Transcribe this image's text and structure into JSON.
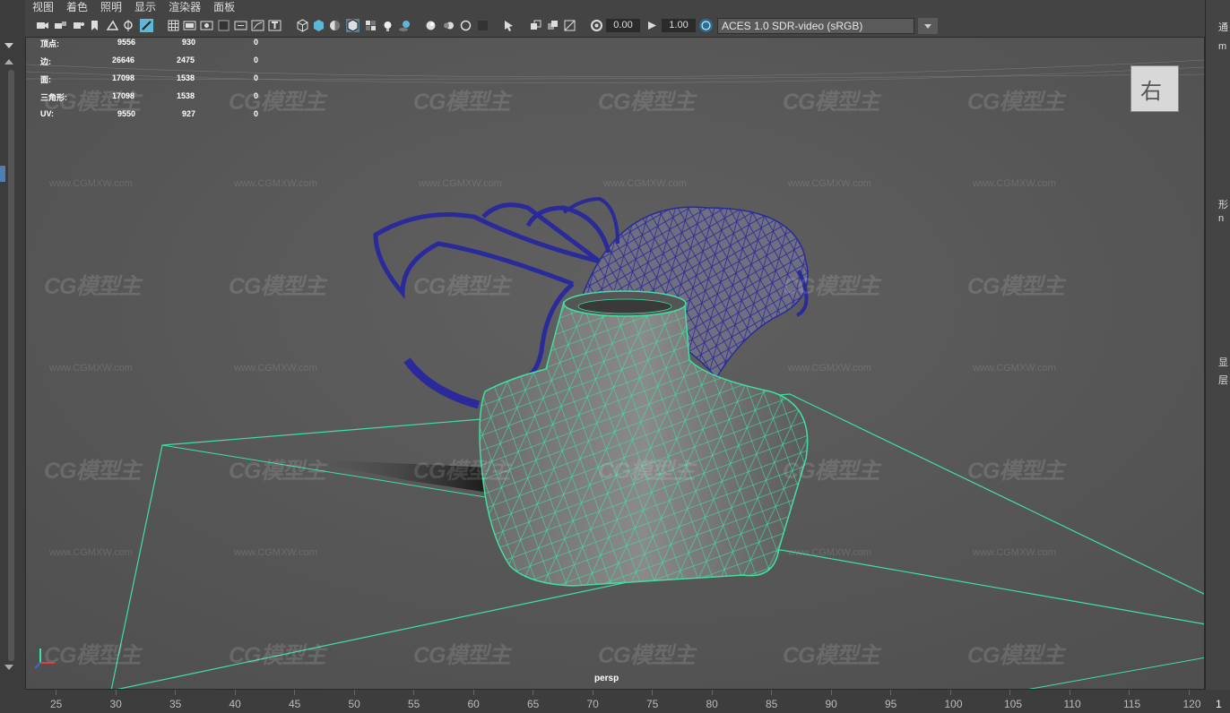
{
  "menu": [
    "视图",
    "着色",
    "照明",
    "显示",
    "渲染器",
    "面板"
  ],
  "toolbar": {
    "exposure_value": "0.00",
    "gamma_value": "1.00",
    "color_space": "ACES 1.0 SDR-video (sRGB)"
  },
  "hud": {
    "rows": [
      {
        "label": "顶点:",
        "values": [
          "9556",
          "930",
          "0"
        ]
      },
      {
        "label": "边:",
        "values": [
          "26646",
          "2475",
          "0"
        ]
      },
      {
        "label": "面:",
        "values": [
          "17098",
          "1538",
          "0"
        ]
      },
      {
        "label": "三角形:",
        "values": [
          "17098",
          "1538",
          "0"
        ]
      },
      {
        "label": "UV:",
        "values": [
          "9550",
          "927",
          "0"
        ]
      }
    ]
  },
  "viewport": {
    "camera_label": "persp",
    "view_cube_label": "右",
    "watermark_logo": "CG模型主",
    "watermark_url": "www.CGMXW.com"
  },
  "right_panel": [
    "通",
    "m",
    "形",
    "n",
    "显",
    "层"
  ],
  "timeline": {
    "ticks": [
      "25",
      "30",
      "35",
      "40",
      "45",
      "50",
      "55",
      "60",
      "65",
      "70",
      "75",
      "80",
      "85",
      "90",
      "95",
      "100",
      "105",
      "110",
      "115",
      "120"
    ],
    "end_label": "1"
  },
  "colors": {
    "viewport_bg": "#5a5a5a",
    "wire_green": "#40e0a0",
    "wire_blue": "#2a2a9a"
  }
}
